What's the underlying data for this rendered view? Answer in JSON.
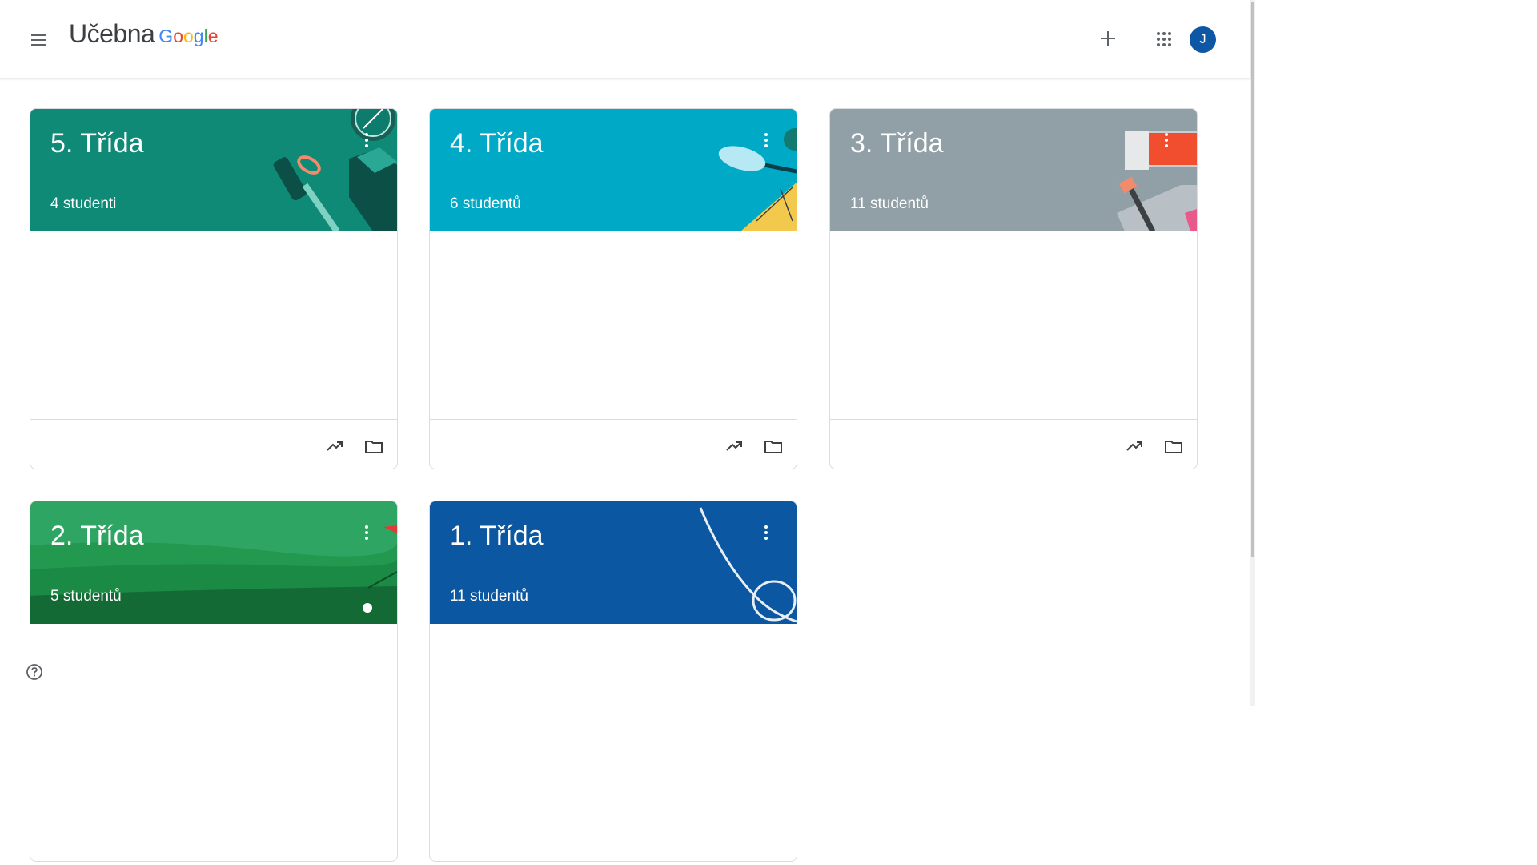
{
  "app": {
    "name": "Učebna",
    "google": [
      "G",
      "o",
      "o",
      "g",
      "l",
      "e"
    ],
    "google_colors": [
      "#4285f4",
      "#ea4335",
      "#fbbc05",
      "#4285f4",
      "#34a853",
      "#ea4335"
    ]
  },
  "header": {
    "menu_icon": "hamburger-menu-icon",
    "add_icon": "plus-icon",
    "apps_icon": "apps-grid-icon",
    "avatar_initial": "J",
    "avatar_color": "#0d57a5"
  },
  "classes": [
    {
      "title": "5. Třída",
      "students": "4 studenti",
      "color": "#0e8a77",
      "illustration": "compass-and-tools"
    },
    {
      "title": "4. Třída",
      "students": "6 studentů",
      "color": "#00a9c5",
      "illustration": "paddle-and-ruler"
    },
    {
      "title": "3. Třída",
      "students": "11 studentů",
      "color": "#919fa7",
      "illustration": "paint-tube-and-brush"
    },
    {
      "title": "2. Třída",
      "students": "5 studentů",
      "color": "#2ea562",
      "illustration": "golf-field"
    },
    {
      "title": "1. Třída",
      "students": "11 studentů",
      "color": "#0c57a1",
      "illustration": "rope-loop"
    }
  ],
  "footer_icons": {
    "progress": "trending-up-icon",
    "folder": "folder-icon"
  },
  "help_icon": "help-circle-icon"
}
